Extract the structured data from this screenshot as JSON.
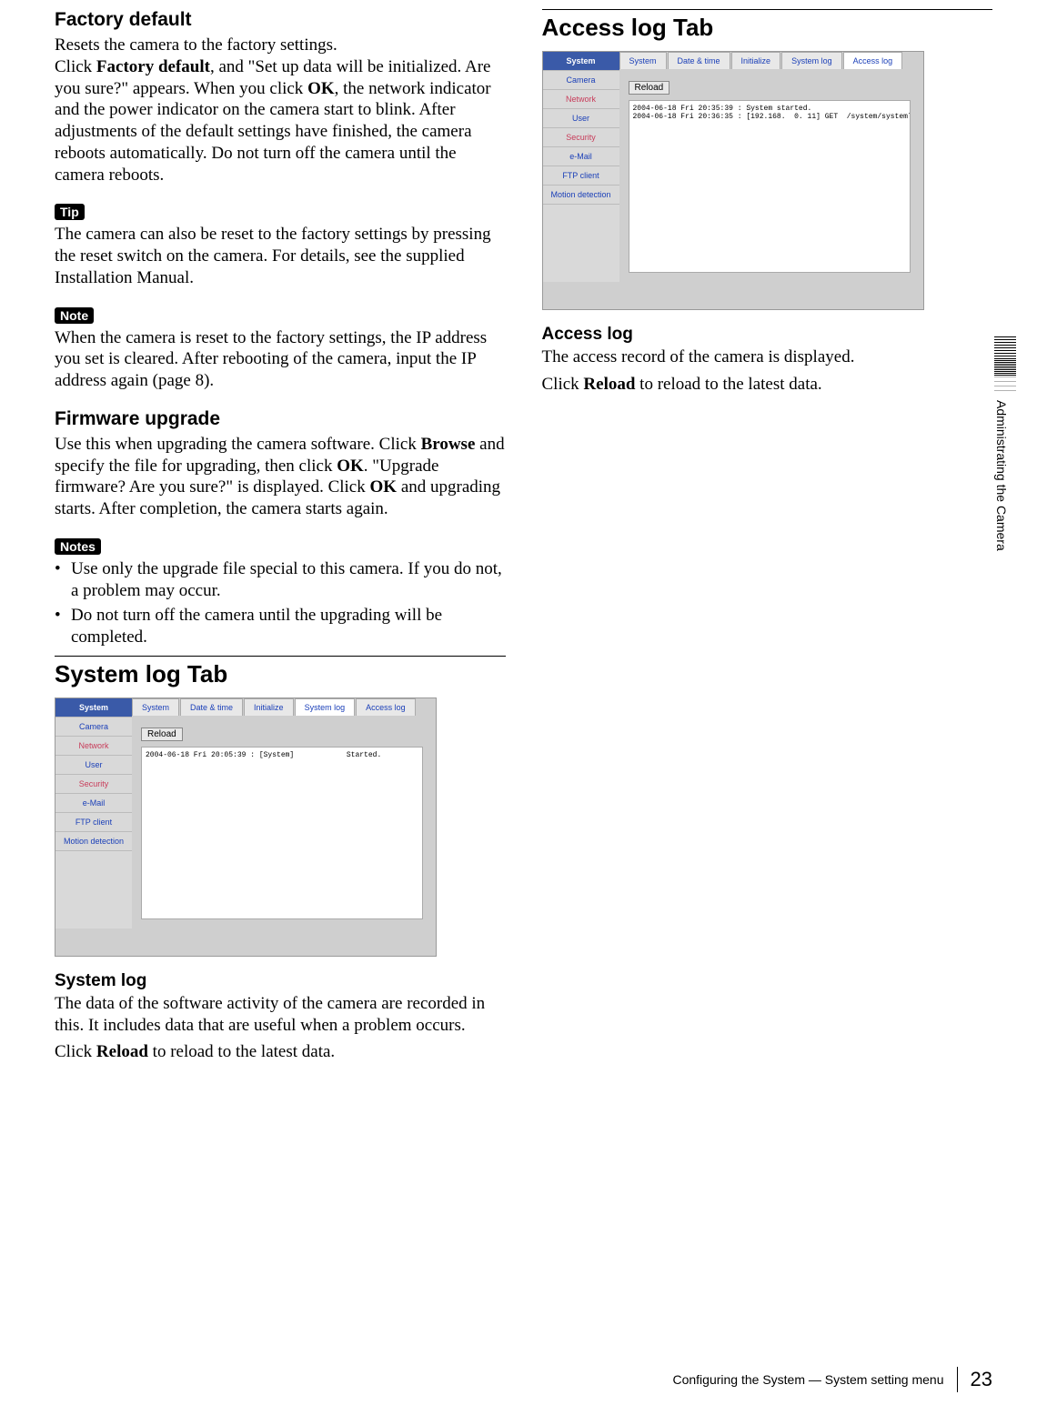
{
  "left": {
    "factory_default": {
      "heading": "Factory default",
      "p1_a": "Resets the camera to the factory settings.",
      "p1_b": "Click ",
      "p1_bold1": "Factory default",
      "p1_c": ", and \"Set up data will be initialized. Are you sure?\" appears. When you click ",
      "p1_bold2": "OK",
      "p1_d": ", the network indicator and the power indicator on the camera start to blink. After adjustments of the default settings have finished, the camera reboots automatically. Do not turn off the camera until the camera reboots.",
      "tip_label": "Tip",
      "tip_text": "The camera can also be reset to the factory settings by pressing the reset switch on the camera. For details, see the supplied Installation Manual.",
      "note_label": "Note",
      "note_text": "When the camera is reset to the factory settings, the IP address you set is cleared. After rebooting of the camera, input the IP address again (page 8)."
    },
    "firmware": {
      "heading": "Firmware upgrade",
      "p_a": "Use this when upgrading the camera software. Click ",
      "bold1": "Browse",
      "p_b": " and specify the file for upgrading, then click ",
      "bold2": "OK",
      "p_c": ". \"Upgrade firmware? Are you sure?\" is displayed. Click ",
      "bold3": "OK",
      "p_d": " and upgrading starts. After completion, the camera starts again.",
      "notes_label": "Notes",
      "note1": "Use only the upgrade file special to this camera. If you do not, a problem may occur.",
      "note2": "Do not turn off the camera until the upgrading will be completed."
    },
    "system_log": {
      "tab_heading": "System log Tab",
      "sub_heading": "System log",
      "p1": "The data of the software activity of the camera are recorded in this. It includes data that are useful when a problem occurs.",
      "p2_a": "Click ",
      "p2_bold": "Reload",
      "p2_b": " to reload to the latest data."
    }
  },
  "right": {
    "access_log": {
      "tab_heading": "Access log Tab",
      "sub_heading": "Access log",
      "p1": "The access record of the camera is displayed.",
      "p2_a": "Click ",
      "p2_bold": "Reload",
      "p2_b": " to reload to the latest data."
    }
  },
  "shot": {
    "side": {
      "header": "System",
      "items": [
        "Camera",
        "Network",
        "User",
        "Security",
        "e-Mail",
        "FTP client",
        "Motion detection"
      ]
    },
    "tabs": [
      "System",
      "Date & time",
      "Initialize",
      "System log",
      "Access log"
    ],
    "reload": "Reload",
    "syslog_active_tab": "System log",
    "accesslog_active_tab": "Access log",
    "syslog_text": "2004-06-18 Fri 20:05:39 : [System]            Started.",
    "accesslog_text": "2004-06-18 Fri 20:35:39 : System started.\n2004-06-18 Fri 20:36:35 : [192.168.  0. 11] GET  /system/systemlog.txt"
  },
  "margin_text": "Administrating the Camera",
  "footer": {
    "text": "Configuring the System — System setting menu",
    "page": "23"
  }
}
